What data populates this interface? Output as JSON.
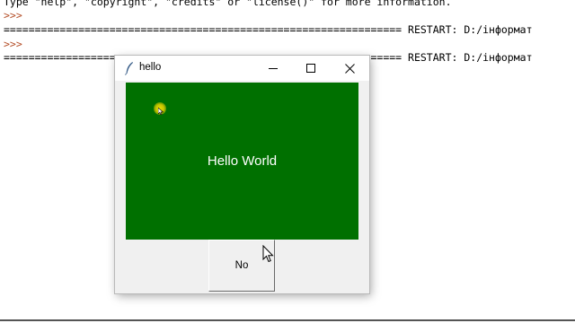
{
  "shell": {
    "banner": "Type \"help\", \"copyright\", \"credits\" or \"license()\" for more information.",
    "prompt": ">>>",
    "separator": "================================================================ RESTART: D:/інформат"
  },
  "window": {
    "title": "hello",
    "icon": "feather-icon",
    "controls": [
      "minimize-icon",
      "maximize-icon",
      "close-icon"
    ]
  },
  "label": {
    "text": "Hello World",
    "bg_color": "#007000",
    "fg_color": "#ffffff"
  },
  "button": {
    "label": "No"
  },
  "colors": {
    "prompt": "#b5502a",
    "cursor_highlight": "#e6e000"
  }
}
